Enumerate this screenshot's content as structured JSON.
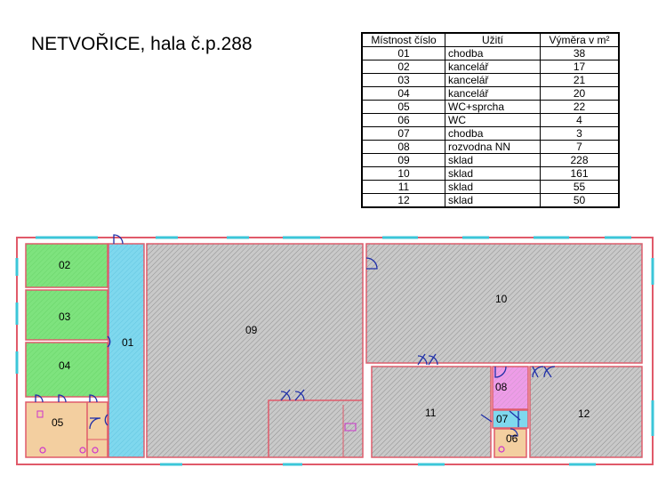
{
  "title": "NETVOŘICE, hala č.p.288",
  "legend": {
    "headers": [
      "Místnost číslo",
      "Užití",
      "Výměra v m²"
    ],
    "rows": [
      {
        "room": "01",
        "use": "chodba",
        "area": "38"
      },
      {
        "room": "02",
        "use": "kancelář",
        "area": "17"
      },
      {
        "room": "03",
        "use": "kancelář",
        "area": "21"
      },
      {
        "room": "04",
        "use": "kancelář",
        "area": "20"
      },
      {
        "room": "05",
        "use": "WC+sprcha",
        "area": "22"
      },
      {
        "room": "06",
        "use": "WC",
        "area": "4"
      },
      {
        "room": "07",
        "use": "chodba",
        "area": "3"
      },
      {
        "room": "08",
        "use": "rozvodna NN",
        "area": "7"
      },
      {
        "room": "09",
        "use": "sklad",
        "area": "228"
      },
      {
        "room": "10",
        "use": "sklad",
        "area": "161"
      },
      {
        "room": "11",
        "use": "sklad",
        "area": "55"
      },
      {
        "room": "12",
        "use": "sklad",
        "area": "50"
      }
    ]
  },
  "plan": {
    "labels": {
      "r01": "01",
      "r02": "02",
      "r03": "03",
      "r04": "04",
      "r05": "05",
      "r06": "06",
      "r07": "07",
      "r08": "08",
      "r09": "09",
      "r10": "10",
      "r11": "11",
      "r12": "12"
    },
    "colors": {
      "wall": "#e05a6a",
      "office": "#7ee37e",
      "corridor": "#7fd8ee",
      "storage": "#c9c9c9",
      "sanitary": "#f3cfa0",
      "electrical": "#ee9ce8",
      "door": "#1f2fa8"
    }
  }
}
